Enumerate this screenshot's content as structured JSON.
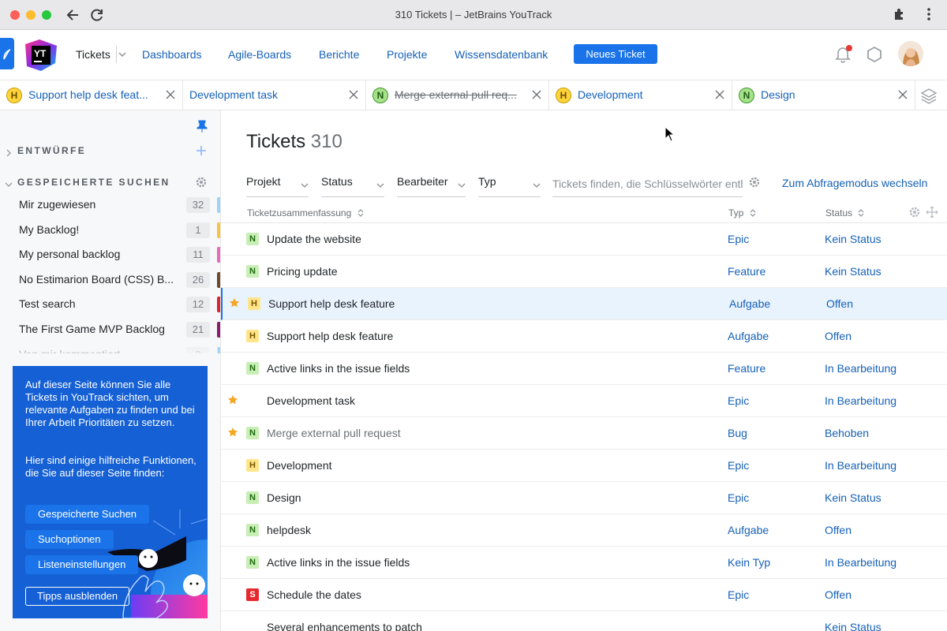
{
  "window": {
    "title": "310 Tickets | – JetBrains YouTrack"
  },
  "header": {
    "logo_text": "YT",
    "nav": [
      "Tickets",
      "Dashboards",
      "Agile-Boards",
      "Berichte",
      "Projekte",
      "Wissensdatenbank"
    ],
    "new_ticket": "Neues Ticket"
  },
  "tabs": [
    {
      "badge": "H",
      "label": "Support help desk feat...",
      "struck": false
    },
    {
      "badge": "",
      "label": "Development task",
      "struck": false
    },
    {
      "badge": "N",
      "label": "Merge external pull req...",
      "struck": true
    },
    {
      "badge": "H",
      "label": "Development",
      "struck": false
    },
    {
      "badge": "N",
      "label": "Design",
      "struck": false
    }
  ],
  "sidebar": {
    "drafts_title": "ENTWÜRFE",
    "saved_title": "GESPEICHERTE SUCHEN",
    "saved": [
      {
        "label": "Mir zugewiesen",
        "count": "32",
        "color": "#9fd4f5"
      },
      {
        "label": "My Backlog!",
        "count": "1",
        "color": "#f6c343"
      },
      {
        "label": "My personal backlog",
        "count": "11",
        "color": "#e86bb8"
      },
      {
        "label": "No Estimarion Board (CSS) B...",
        "count": "26",
        "color": "#6e4a2c"
      },
      {
        "label": "Test search",
        "count": "12",
        "color": "#d9262c"
      },
      {
        "label": "The First Game MVP Backlog",
        "count": "21",
        "color": "#8b1d6b"
      },
      {
        "label": "Von mir kommentiert",
        "count": "3",
        "color": "#9fd4f5"
      }
    ],
    "tips": {
      "text1": "Auf dieser Seite können Sie alle Tickets in YouTrack sichten, um relevante Aufgaben zu finden und bei Ihrer Arbeit Prioritäten zu setzen.",
      "text2": "Hier sind einige hilfreiche Funktionen, die Sie auf dieser Seite finden:",
      "buttons": [
        "Gespeicherte Suchen",
        "Suchoptionen",
        "Listeneinstellungen"
      ],
      "hide": "Tipps ausblenden"
    }
  },
  "main": {
    "title": "Tickets",
    "count": "310",
    "filters": [
      "Projekt",
      "Status",
      "Bearbeiter",
      "Typ"
    ],
    "search_placeholder": "Tickets finden, die Schlüsselwörter enthalten",
    "query_mode": "Zum Abfragemodus wechseln",
    "columns": {
      "summary": "Ticketzusammenfassung",
      "type": "Typ",
      "status": "Status"
    },
    "rows": [
      {
        "star": false,
        "badge": "N",
        "summary": "Update the website",
        "type": "Epic",
        "status": "Kein Status",
        "selected": false,
        "resolved": false
      },
      {
        "star": false,
        "badge": "N",
        "summary": "Pricing update",
        "type": "Feature",
        "status": "Kein Status",
        "selected": false,
        "resolved": false
      },
      {
        "star": true,
        "badge": "H",
        "summary": "Support help desk feature",
        "type": "Aufgabe",
        "status": "Offen",
        "selected": true,
        "resolved": false
      },
      {
        "star": false,
        "badge": "H",
        "summary": "Support help desk feature",
        "type": "Aufgabe",
        "status": "Offen",
        "selected": false,
        "resolved": false
      },
      {
        "star": false,
        "badge": "N",
        "summary": "Active links in the issue fields",
        "type": "Feature",
        "status": "In Bearbeitung",
        "selected": false,
        "resolved": false
      },
      {
        "star": true,
        "badge": "",
        "summary": "Development task",
        "type": "Epic",
        "status": "In Bearbeitung",
        "selected": false,
        "resolved": false
      },
      {
        "star": true,
        "badge": "N",
        "summary": "Merge external pull request",
        "type": "Bug",
        "status": "Behoben",
        "selected": false,
        "resolved": true
      },
      {
        "star": false,
        "badge": "H",
        "summary": "Development",
        "type": "Epic",
        "status": "In Bearbeitung",
        "selected": false,
        "resolved": false
      },
      {
        "star": false,
        "badge": "N",
        "summary": "Design",
        "type": "Epic",
        "status": "Kein Status",
        "selected": false,
        "resolved": false
      },
      {
        "star": false,
        "badge": "N",
        "summary": "helpdesk",
        "type": "Aufgabe",
        "status": "Offen",
        "selected": false,
        "resolved": false
      },
      {
        "star": false,
        "badge": "N",
        "summary": "Active links in the issue fields",
        "type": "Kein Typ",
        "status": "In Bearbeitung",
        "selected": false,
        "resolved": false
      },
      {
        "star": false,
        "badge": "S",
        "summary": "Schedule the dates",
        "type": "Epic",
        "status": "Offen",
        "selected": false,
        "resolved": false
      },
      {
        "star": false,
        "badge": "",
        "summary": "Several enhancements to patch",
        "type": "",
        "status": "Kein Status",
        "selected": false,
        "resolved": false
      }
    ]
  }
}
